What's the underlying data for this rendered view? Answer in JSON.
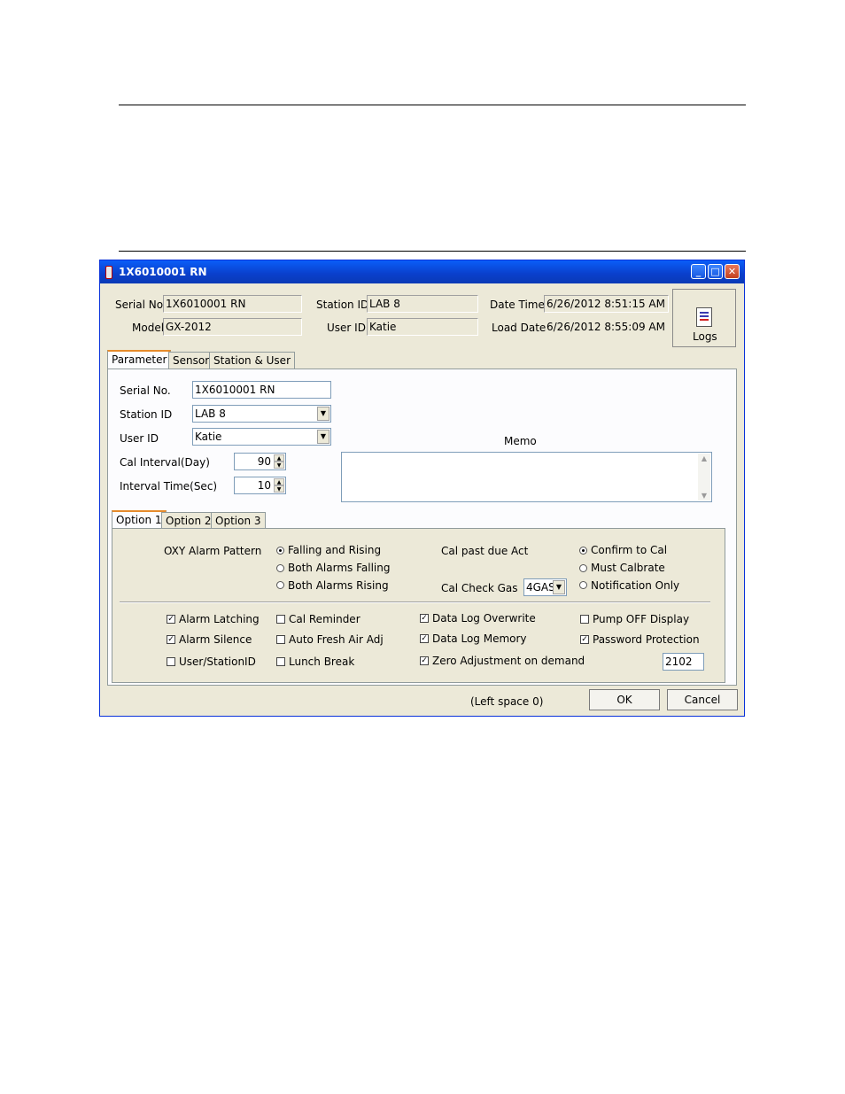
{
  "window": {
    "title": "1X6010001 RN",
    "controls": {
      "minimize": "_",
      "maximize": "□",
      "close": "✕"
    }
  },
  "header": {
    "serial_label": "Serial No.",
    "serial_value": "1X6010001 RN",
    "model_label": "Model",
    "model_value": "GX-2012",
    "station_label": "Station ID",
    "station_value": "LAB 8",
    "user_label": "User ID",
    "user_value": "Katie",
    "datetime_label": "Date Time",
    "datetime_value": "6/26/2012 8:51:15 AM",
    "loaddate_label": "Load Date",
    "loaddate_value": "6/26/2012 8:55:09 AM",
    "logs_label": "Logs"
  },
  "tabs": [
    "Parameter",
    "Sensor",
    "Station & User"
  ],
  "parameter": {
    "serial_label": "Serial No.",
    "serial_value": "1X6010001 RN",
    "station_label": "Station ID",
    "station_value": "LAB 8",
    "user_label": "User ID",
    "user_value": "Katie",
    "cal_interval_label": "Cal Interval(Day)",
    "cal_interval_value": "90",
    "interval_time_label": "Interval Time(Sec)",
    "interval_time_value": "10",
    "memo_label": "Memo",
    "memo_value": ""
  },
  "option_tabs": [
    "Option 1",
    "Option 2",
    "Option 3"
  ],
  "options": {
    "oxy_label": "OXY Alarm Pattern",
    "oxy_options": [
      {
        "label": "Falling and Rising",
        "selected": true
      },
      {
        "label": "Both Alarms Falling",
        "selected": false
      },
      {
        "label": "Both Alarms Rising",
        "selected": false
      }
    ],
    "cal_past_label": "Cal past due Act",
    "cal_past_options": [
      {
        "label": "Confirm to Cal",
        "selected": true
      },
      {
        "label": "Must Calbrate",
        "selected": false
      },
      {
        "label": "Notification Only",
        "selected": false
      }
    ],
    "cal_check_gas_label": "Cal Check Gas",
    "cal_check_gas_value": "4GAS",
    "checkboxes": [
      {
        "label": "Alarm Latching",
        "checked": true
      },
      {
        "label": "Alarm Silence",
        "checked": true
      },
      {
        "label": "User/StationID",
        "checked": false
      },
      {
        "label": "Cal Reminder",
        "checked": false
      },
      {
        "label": "Auto Fresh Air Adj",
        "checked": false
      },
      {
        "label": "Lunch Break",
        "checked": false
      },
      {
        "label": "Data Log Overwrite",
        "checked": true
      },
      {
        "label": "Data Log Memory",
        "checked": true
      },
      {
        "label": "Zero Adjustment on demand",
        "checked": true
      },
      {
        "label": "Pump OFF Display",
        "checked": false
      },
      {
        "label": "Password Protection",
        "checked": true
      }
    ],
    "password_value": "2102"
  },
  "footer": {
    "left_space": "(Left space 0)",
    "ok_label": "OK",
    "cancel_label": "Cancel"
  }
}
